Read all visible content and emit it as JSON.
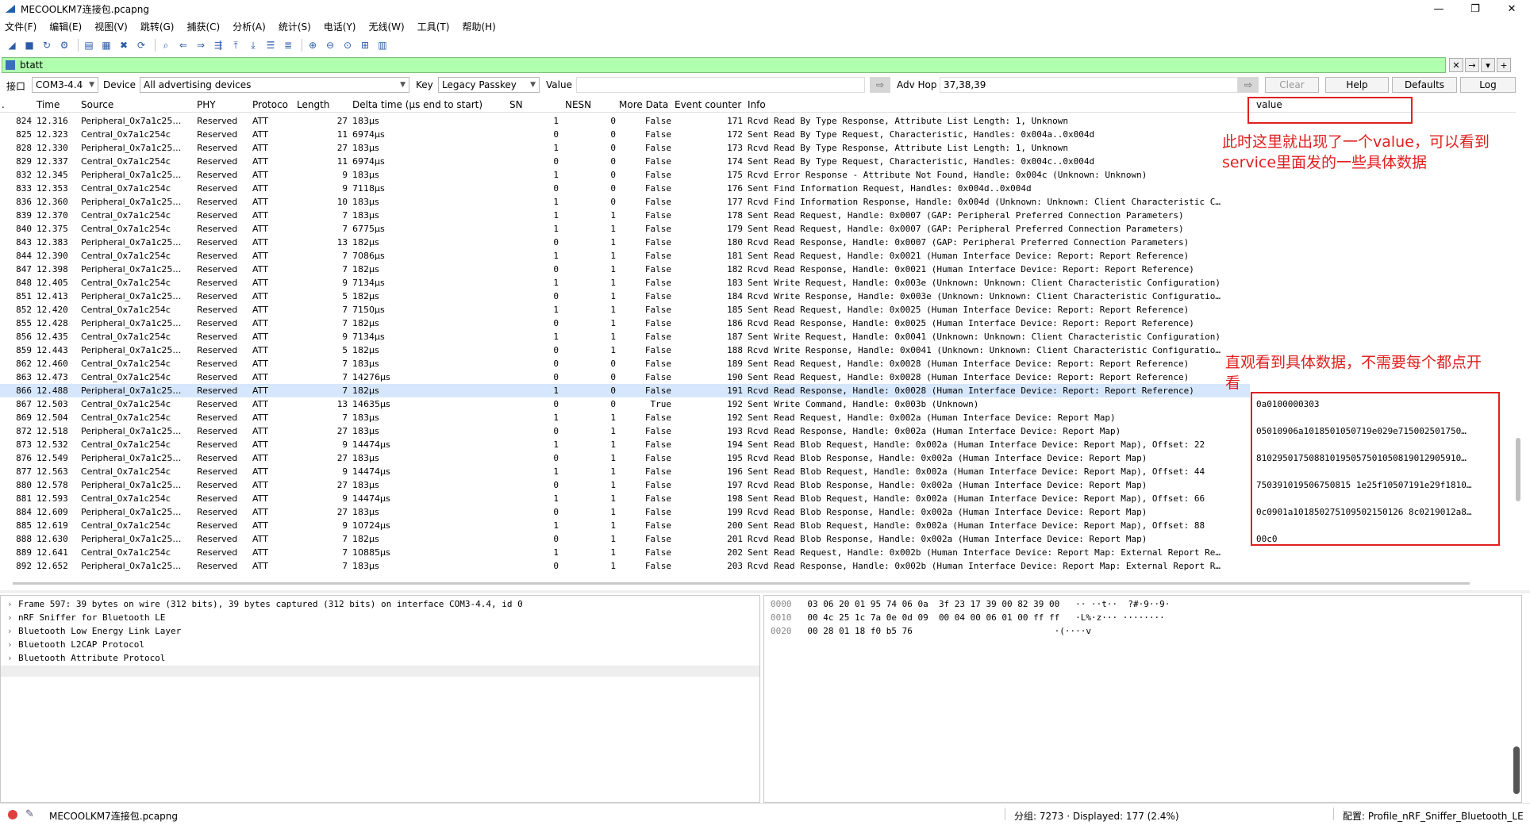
{
  "window": {
    "title": "MECOOLKM7连接包.pcapng",
    "minimize": "—",
    "maximize": "❐",
    "close": "✕"
  },
  "menu": [
    "文件(F)",
    "编辑(E)",
    "视图(V)",
    "跳转(G)",
    "捕获(C)",
    "分析(A)",
    "统计(S)",
    "电话(Y)",
    "无线(W)",
    "工具(T)",
    "帮助(H)"
  ],
  "filter": {
    "value": "btatt"
  },
  "sniffer": {
    "interface_label": "接口",
    "interface_value": "COM3-4.4",
    "device_label": "Device",
    "device_value": "All advertising devices",
    "key_label": "Key",
    "key_value": "Legacy Passkey",
    "value_label": "Value",
    "adv_hop_label": "Adv Hop",
    "adv_hop_value": "37,38,39",
    "clear": "Clear",
    "help": "Help",
    "defaults": "Defaults",
    "log": "Log"
  },
  "columns": {
    "no": ".",
    "time": "Time",
    "source": "Source",
    "phy": "PHY",
    "protocol": "Protoco",
    "length": "Length",
    "delta": "Delta time (µs end to start)",
    "sn": "SN",
    "nesn": "NESN",
    "more": "More Data",
    "event": "Event counter",
    "info": "Info",
    "value": "value"
  },
  "packets": [
    {
      "no": "824",
      "time": "12.316",
      "src": "Peripheral_0x7a1c25…",
      "phy": "Reserved",
      "prot": "ATT",
      "len": "27",
      "delta": "183µs",
      "sn": "1",
      "nesn": "0",
      "more": "False",
      "event": "171",
      "info": "Rcvd Read By Type Response, Attribute List Length: 1, Unknown"
    },
    {
      "no": "825",
      "time": "12.323",
      "src": "Central_0x7a1c254c",
      "phy": "Reserved",
      "prot": "ATT",
      "len": "11",
      "delta": "6974µs",
      "sn": "0",
      "nesn": "0",
      "more": "False",
      "event": "172",
      "info": "Sent Read By Type Request, Characteristic, Handles: 0x004a..0x004d"
    },
    {
      "no": "828",
      "time": "12.330",
      "src": "Peripheral_0x7a1c25…",
      "phy": "Reserved",
      "prot": "ATT",
      "len": "27",
      "delta": "183µs",
      "sn": "1",
      "nesn": "0",
      "more": "False",
      "event": "173",
      "info": "Rcvd Read By Type Response, Attribute List Length: 1, Unknown"
    },
    {
      "no": "829",
      "time": "12.337",
      "src": "Central_0x7a1c254c",
      "phy": "Reserved",
      "prot": "ATT",
      "len": "11",
      "delta": "6974µs",
      "sn": "0",
      "nesn": "0",
      "more": "False",
      "event": "174",
      "info": "Sent Read By Type Request, Characteristic, Handles: 0x004c..0x004d"
    },
    {
      "no": "832",
      "time": "12.345",
      "src": "Peripheral_0x7a1c25…",
      "phy": "Reserved",
      "prot": "ATT",
      "len": "9",
      "delta": "183µs",
      "sn": "1",
      "nesn": "0",
      "more": "False",
      "event": "175",
      "info": "Rcvd Error Response - Attribute Not Found, Handle: 0x004c (Unknown: Unknown)"
    },
    {
      "no": "833",
      "time": "12.353",
      "src": "Central_0x7a1c254c",
      "phy": "Reserved",
      "prot": "ATT",
      "len": "9",
      "delta": "7118µs",
      "sn": "0",
      "nesn": "0",
      "more": "False",
      "event": "176",
      "info": "Sent Find Information Request, Handles: 0x004d..0x004d"
    },
    {
      "no": "836",
      "time": "12.360",
      "src": "Peripheral_0x7a1c25…",
      "phy": "Reserved",
      "prot": "ATT",
      "len": "10",
      "delta": "183µs",
      "sn": "1",
      "nesn": "0",
      "more": "False",
      "event": "177",
      "info": "Rcvd Find Information Response, Handle: 0x004d (Unknown: Unknown: Client Characteristic C…"
    },
    {
      "no": "839",
      "time": "12.370",
      "src": "Central_0x7a1c254c",
      "phy": "Reserved",
      "prot": "ATT",
      "len": "7",
      "delta": "183µs",
      "sn": "1",
      "nesn": "1",
      "more": "False",
      "event": "178",
      "info": "Sent Read Request, Handle: 0x0007 (GAP: Peripheral Preferred Connection Parameters)"
    },
    {
      "no": "840",
      "time": "12.375",
      "src": "Central_0x7a1c254c",
      "phy": "Reserved",
      "prot": "ATT",
      "len": "7",
      "delta": "6775µs",
      "sn": "1",
      "nesn": "1",
      "more": "False",
      "event": "179",
      "info": "Sent Read Request, Handle: 0x0007 (GAP: Peripheral Preferred Connection Parameters)"
    },
    {
      "no": "843",
      "time": "12.383",
      "src": "Peripheral_0x7a1c25…",
      "phy": "Reserved",
      "prot": "ATT",
      "len": "13",
      "delta": "182µs",
      "sn": "0",
      "nesn": "1",
      "more": "False",
      "event": "180",
      "info": "Rcvd Read Response, Handle: 0x0007 (GAP: Peripheral Preferred Connection Parameters)"
    },
    {
      "no": "844",
      "time": "12.390",
      "src": "Central_0x7a1c254c",
      "phy": "Reserved",
      "prot": "ATT",
      "len": "7",
      "delta": "7086µs",
      "sn": "1",
      "nesn": "1",
      "more": "False",
      "event": "181",
      "info": "Sent Read Request, Handle: 0x0021 (Human Interface Device: Report: Report Reference)"
    },
    {
      "no": "847",
      "time": "12.398",
      "src": "Peripheral_0x7a1c25…",
      "phy": "Reserved",
      "prot": "ATT",
      "len": "7",
      "delta": "182µs",
      "sn": "0",
      "nesn": "1",
      "more": "False",
      "event": "182",
      "info": "Rcvd Read Response, Handle: 0x0021 (Human Interface Device: Report: Report Reference)"
    },
    {
      "no": "848",
      "time": "12.405",
      "src": "Central_0x7a1c254c",
      "phy": "Reserved",
      "prot": "ATT",
      "len": "9",
      "delta": "7134µs",
      "sn": "1",
      "nesn": "1",
      "more": "False",
      "event": "183",
      "info": "Sent Write Request, Handle: 0x003e (Unknown: Unknown: Client Characteristic Configuration)"
    },
    {
      "no": "851",
      "time": "12.413",
      "src": "Peripheral_0x7a1c25…",
      "phy": "Reserved",
      "prot": "ATT",
      "len": "5",
      "delta": "182µs",
      "sn": "0",
      "nesn": "1",
      "more": "False",
      "event": "184",
      "info": "Rcvd Write Response, Handle: 0x003e (Unknown: Unknown: Client Characteristic Configuratio…"
    },
    {
      "no": "852",
      "time": "12.420",
      "src": "Central_0x7a1c254c",
      "phy": "Reserved",
      "prot": "ATT",
      "len": "7",
      "delta": "7150µs",
      "sn": "1",
      "nesn": "1",
      "more": "False",
      "event": "185",
      "info": "Sent Read Request, Handle: 0x0025 (Human Interface Device: Report: Report Reference)"
    },
    {
      "no": "855",
      "time": "12.428",
      "src": "Peripheral_0x7a1c25…",
      "phy": "Reserved",
      "prot": "ATT",
      "len": "7",
      "delta": "182µs",
      "sn": "0",
      "nesn": "1",
      "more": "False",
      "event": "186",
      "info": "Rcvd Read Response, Handle: 0x0025 (Human Interface Device: Report: Report Reference)"
    },
    {
      "no": "856",
      "time": "12.435",
      "src": "Central_0x7a1c254c",
      "phy": "Reserved",
      "prot": "ATT",
      "len": "9",
      "delta": "7134µs",
      "sn": "1",
      "nesn": "1",
      "more": "False",
      "event": "187",
      "info": "Sent Write Request, Handle: 0x0041 (Unknown: Unknown: Client Characteristic Configuration)"
    },
    {
      "no": "859",
      "time": "12.443",
      "src": "Peripheral_0x7a1c25…",
      "phy": "Reserved",
      "prot": "ATT",
      "len": "5",
      "delta": "182µs",
      "sn": "0",
      "nesn": "1",
      "more": "False",
      "event": "188",
      "info": "Rcvd Write Response, Handle: 0x0041 (Unknown: Unknown: Client Characteristic Configuratio…"
    },
    {
      "no": "862",
      "time": "12.460",
      "src": "Central_0x7a1c254c",
      "phy": "Reserved",
      "prot": "ATT",
      "len": "7",
      "delta": "183µs",
      "sn": "0",
      "nesn": "0",
      "more": "False",
      "event": "189",
      "info": "Sent Read Request, Handle: 0x0028 (Human Interface Device: Report: Report Reference)"
    },
    {
      "no": "863",
      "time": "12.473",
      "src": "Central_0x7a1c254c",
      "phy": "Reserved",
      "prot": "ATT",
      "len": "7",
      "delta": "14276µs",
      "sn": "0",
      "nesn": "0",
      "more": "False",
      "event": "190",
      "info": "Sent Read Request, Handle: 0x0028 (Human Interface Device: Report: Report Reference)"
    },
    {
      "no": "866",
      "time": "12.488",
      "src": "Peripheral_0x7a1c25…",
      "phy": "Reserved",
      "prot": "ATT",
      "len": "7",
      "delta": "182µs",
      "sn": "1",
      "nesn": "0",
      "more": "False",
      "event": "191",
      "info": "Rcvd Read Response, Handle: 0x0028 (Human Interface Device: Report: Report Reference)",
      "selected": true
    },
    {
      "no": "867",
      "time": "12.503",
      "src": "Central_0x7a1c254c",
      "phy": "Reserved",
      "prot": "ATT",
      "len": "13",
      "delta": "14635µs",
      "sn": "0",
      "nesn": "0",
      "more": "True",
      "event": "192",
      "info": "Sent Write Command, Handle: 0x003b (Unknown)"
    },
    {
      "no": "869",
      "time": "12.504",
      "src": "Central_0x7a1c254c",
      "phy": "Reserved",
      "prot": "ATT",
      "len": "7",
      "delta": "183µs",
      "sn": "1",
      "nesn": "1",
      "more": "False",
      "event": "192",
      "info": "Sent Read Request, Handle: 0x002a (Human Interface Device: Report Map)"
    },
    {
      "no": "872",
      "time": "12.518",
      "src": "Peripheral_0x7a1c25…",
      "phy": "Reserved",
      "prot": "ATT",
      "len": "27",
      "delta": "183µs",
      "sn": "0",
      "nesn": "1",
      "more": "False",
      "event": "193",
      "info": "Rcvd Read Response, Handle: 0x002a (Human Interface Device: Report Map)"
    },
    {
      "no": "873",
      "time": "12.532",
      "src": "Central_0x7a1c254c",
      "phy": "Reserved",
      "prot": "ATT",
      "len": "9",
      "delta": "14474µs",
      "sn": "1",
      "nesn": "1",
      "more": "False",
      "event": "194",
      "info": "Sent Read Blob Request, Handle: 0x002a (Human Interface Device: Report Map), Offset: 22"
    },
    {
      "no": "876",
      "time": "12.549",
      "src": "Peripheral_0x7a1c25…",
      "phy": "Reserved",
      "prot": "ATT",
      "len": "27",
      "delta": "183µs",
      "sn": "0",
      "nesn": "1",
      "more": "False",
      "event": "195",
      "info": "Rcvd Read Blob Response, Handle: 0x002a (Human Interface Device: Report Map)"
    },
    {
      "no": "877",
      "time": "12.563",
      "src": "Central_0x7a1c254c",
      "phy": "Reserved",
      "prot": "ATT",
      "len": "9",
      "delta": "14474µs",
      "sn": "1",
      "nesn": "1",
      "more": "False",
      "event": "196",
      "info": "Sent Read Blob Request, Handle: 0x002a (Human Interface Device: Report Map), Offset: 44"
    },
    {
      "no": "880",
      "time": "12.578",
      "src": "Peripheral_0x7a1c25…",
      "phy": "Reserved",
      "prot": "ATT",
      "len": "27",
      "delta": "183µs",
      "sn": "0",
      "nesn": "1",
      "more": "False",
      "event": "197",
      "info": "Rcvd Read Blob Response, Handle: 0x002a (Human Interface Device: Report Map)"
    },
    {
      "no": "881",
      "time": "12.593",
      "src": "Central_0x7a1c254c",
      "phy": "Reserved",
      "prot": "ATT",
      "len": "9",
      "delta": "14474µs",
      "sn": "1",
      "nesn": "1",
      "more": "False",
      "event": "198",
      "info": "Sent Read Blob Request, Handle: 0x002a (Human Interface Device: Report Map), Offset: 66"
    },
    {
      "no": "884",
      "time": "12.609",
      "src": "Peripheral_0x7a1c25…",
      "phy": "Reserved",
      "prot": "ATT",
      "len": "27",
      "delta": "183µs",
      "sn": "0",
      "nesn": "1",
      "more": "False",
      "event": "199",
      "info": "Rcvd Read Blob Response, Handle: 0x002a (Human Interface Device: Report Map)"
    },
    {
      "no": "885",
      "time": "12.619",
      "src": "Central_0x7a1c254c",
      "phy": "Reserved",
      "prot": "ATT",
      "len": "9",
      "delta": "10724µs",
      "sn": "1",
      "nesn": "1",
      "more": "False",
      "event": "200",
      "info": "Sent Read Blob Request, Handle: 0x002a (Human Interface Device: Report Map), Offset: 88"
    },
    {
      "no": "888",
      "time": "12.630",
      "src": "Peripheral_0x7a1c25…",
      "phy": "Reserved",
      "prot": "ATT",
      "len": "7",
      "delta": "182µs",
      "sn": "0",
      "nesn": "1",
      "more": "False",
      "event": "201",
      "info": "Rcvd Read Blob Response, Handle: 0x002a (Human Interface Device: Report Map)"
    },
    {
      "no": "889",
      "time": "12.641",
      "src": "Central_0x7a1c254c",
      "phy": "Reserved",
      "prot": "ATT",
      "len": "7",
      "delta": "10885µs",
      "sn": "1",
      "nesn": "1",
      "more": "False",
      "event": "202",
      "info": "Sent Read Request, Handle: 0x002b (Human Interface Device: Report Map: External Report Re…"
    },
    {
      "no": "892",
      "time": "12.652",
      "src": "Peripheral_0x7a1c25…",
      "phy": "Reserved",
      "prot": "ATT",
      "len": "7",
      "delta": "183µs",
      "sn": "0",
      "nesn": "1",
      "more": "False",
      "event": "203",
      "info": "Rcvd Read Response, Handle: 0x002b (Human Interface Device: Report Map: External Report R…"
    }
  ],
  "values": [
    {
      "row": 21,
      "text": "0a0100000303"
    },
    {
      "row": 23,
      "text": "05010906a1018501050719e029e715002501750…"
    },
    {
      "row": 25,
      "text": "810295017508810195057501050819012905910…"
    },
    {
      "row": 27,
      "text": "750391019506750815 1e25f10507191e29f1810…"
    },
    {
      "row": 29,
      "text": "0c0901a101850275109502150126 8c0219012a8…"
    },
    {
      "row": 31,
      "text": "00c0"
    }
  ],
  "annotations": {
    "top": "此时这里就出现了一个value，可以看到service里面发的一些具体数据",
    "bottom": "直观看到具体数据，不需要每个都点开看"
  },
  "details": [
    "Frame 597: 39 bytes on wire (312 bits), 39 bytes captured (312 bits) on interface COM3-4.4, id 0",
    "nRF Sniffer for Bluetooth LE",
    "Bluetooth Low Energy Link Layer",
    "Bluetooth L2CAP Protocol",
    "Bluetooth Attribute Protocol"
  ],
  "bytes": [
    {
      "offset": "0000",
      "hex": "03 06 20 01 95 74 06 0a  3f 23 17 39 00 82 39 00",
      "ascii": "·· ··t··  ?#·9··9·"
    },
    {
      "offset": "0010",
      "hex": "00 4c 25 1c 7a 0e 0d 09  00 04 00 06 01 00 ff ff",
      "ascii": "·L%·z··· ········"
    },
    {
      "offset": "0020",
      "hex": "00 28 01 18 f0 b5 76",
      "ascii": "·(····v"
    }
  ],
  "status": {
    "file": "MECOOLKM7连接包.pcapng",
    "counts": "分组: 7273 · Displayed: 177 (2.4%)",
    "profile": "配置: Profile_nRF_Sniffer_Bluetooth_LE"
  }
}
